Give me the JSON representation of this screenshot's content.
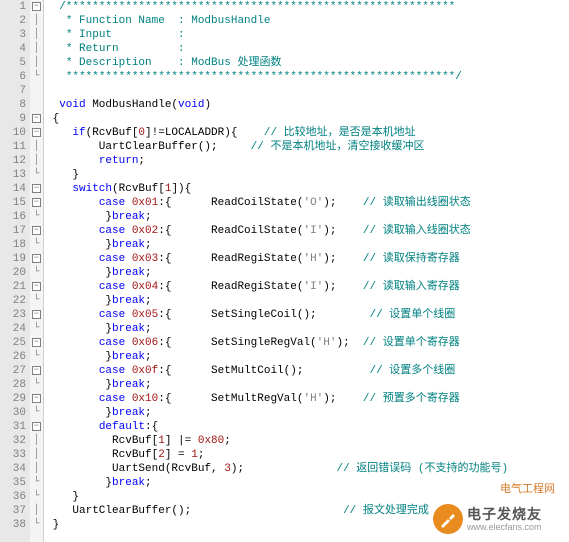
{
  "lines": [
    {
      "n": 1,
      "fold": "box",
      "segs": [
        {
          "txt": "  ",
          "cls": ""
        },
        {
          "txt": "/***********************************************************",
          "cls": "cmt"
        }
      ]
    },
    {
      "n": 2,
      "fold": "|",
      "segs": [
        {
          "txt": "   ",
          "cls": ""
        },
        {
          "txt": "* Function Name  : ModbusHandle",
          "cls": "cmt"
        }
      ]
    },
    {
      "n": 3,
      "fold": "|",
      "segs": [
        {
          "txt": "   ",
          "cls": ""
        },
        {
          "txt": "* Input          :",
          "cls": "cmt"
        }
      ]
    },
    {
      "n": 4,
      "fold": "|",
      "segs": [
        {
          "txt": "   ",
          "cls": ""
        },
        {
          "txt": "* Return         :",
          "cls": "cmt"
        }
      ]
    },
    {
      "n": 5,
      "fold": "|",
      "segs": [
        {
          "txt": "   ",
          "cls": ""
        },
        {
          "txt": "* Description    : ModBus 处理函数",
          "cls": "cmt"
        }
      ]
    },
    {
      "n": 6,
      "fold": "L",
      "segs": [
        {
          "txt": "   ",
          "cls": ""
        },
        {
          "txt": "***********************************************************/",
          "cls": "cmt"
        }
      ]
    },
    {
      "n": 7,
      "fold": " ",
      "segs": [
        {
          "txt": "",
          "cls": ""
        }
      ]
    },
    {
      "n": 8,
      "fold": " ",
      "segs": [
        {
          "txt": "  ",
          "cls": ""
        },
        {
          "txt": "void",
          "cls": "kw"
        },
        {
          "txt": " ModbusHandle(",
          "cls": ""
        },
        {
          "txt": "void",
          "cls": "kw"
        },
        {
          "txt": ")",
          "cls": ""
        }
      ]
    },
    {
      "n": 9,
      "fold": "box",
      "segs": [
        {
          "txt": " {",
          "cls": ""
        }
      ]
    },
    {
      "n": 10,
      "fold": "box",
      "segs": [
        {
          "txt": "    ",
          "cls": ""
        },
        {
          "txt": "if",
          "cls": "kw"
        },
        {
          "txt": "(RcvBuf[",
          "cls": ""
        },
        {
          "txt": "0",
          "cls": "num"
        },
        {
          "txt": "]!=LOCALADDR){    ",
          "cls": ""
        },
        {
          "txt": "// 比较地址，是否是本机地址",
          "cls": "cmt"
        }
      ]
    },
    {
      "n": 11,
      "fold": "|",
      "segs": [
        {
          "txt": "        UartClearBuffer();     ",
          "cls": ""
        },
        {
          "txt": "// 不是本机地址，清空接收缓冲区",
          "cls": "cmt"
        }
      ]
    },
    {
      "n": 12,
      "fold": "|",
      "segs": [
        {
          "txt": "        ",
          "cls": ""
        },
        {
          "txt": "return",
          "cls": "kw"
        },
        {
          "txt": ";",
          "cls": ""
        }
      ]
    },
    {
      "n": 13,
      "fold": "L",
      "segs": [
        {
          "txt": "    }",
          "cls": ""
        }
      ]
    },
    {
      "n": 14,
      "fold": "box",
      "segs": [
        {
          "txt": "    ",
          "cls": ""
        },
        {
          "txt": "switch",
          "cls": "kw"
        },
        {
          "txt": "(RcvBuf[",
          "cls": ""
        },
        {
          "txt": "1",
          "cls": "num"
        },
        {
          "txt": "]){",
          "cls": ""
        }
      ]
    },
    {
      "n": 15,
      "fold": "box",
      "segs": [
        {
          "txt": "        ",
          "cls": ""
        },
        {
          "txt": "case",
          "cls": "kw"
        },
        {
          "txt": " ",
          "cls": ""
        },
        {
          "txt": "0x01",
          "cls": "num"
        },
        {
          "txt": ":{      ReadCoilState(",
          "cls": ""
        },
        {
          "txt": "'O'",
          "cls": "str"
        },
        {
          "txt": ");    ",
          "cls": ""
        },
        {
          "txt": "// 读取输出线圈状态",
          "cls": "cmt"
        }
      ]
    },
    {
      "n": 16,
      "fold": "L",
      "segs": [
        {
          "txt": "         }",
          "cls": ""
        },
        {
          "txt": "break",
          "cls": "kw"
        },
        {
          "txt": ";",
          "cls": ""
        }
      ]
    },
    {
      "n": 17,
      "fold": "box",
      "segs": [
        {
          "txt": "        ",
          "cls": ""
        },
        {
          "txt": "case",
          "cls": "kw"
        },
        {
          "txt": " ",
          "cls": ""
        },
        {
          "txt": "0x02",
          "cls": "num"
        },
        {
          "txt": ":{      ReadCoilState(",
          "cls": ""
        },
        {
          "txt": "'I'",
          "cls": "str"
        },
        {
          "txt": ");    ",
          "cls": ""
        },
        {
          "txt": "// 读取输入线圈状态",
          "cls": "cmt"
        }
      ]
    },
    {
      "n": 18,
      "fold": "L",
      "segs": [
        {
          "txt": "         }",
          "cls": ""
        },
        {
          "txt": "break",
          "cls": "kw"
        },
        {
          "txt": ";",
          "cls": ""
        }
      ]
    },
    {
      "n": 19,
      "fold": "box",
      "segs": [
        {
          "txt": "        ",
          "cls": ""
        },
        {
          "txt": "case",
          "cls": "kw"
        },
        {
          "txt": " ",
          "cls": ""
        },
        {
          "txt": "0x03",
          "cls": "num"
        },
        {
          "txt": ":{      ReadRegiState(",
          "cls": ""
        },
        {
          "txt": "'H'",
          "cls": "str"
        },
        {
          "txt": ");    ",
          "cls": ""
        },
        {
          "txt": "// 读取保持寄存器",
          "cls": "cmt"
        }
      ]
    },
    {
      "n": 20,
      "fold": "L",
      "segs": [
        {
          "txt": "         }",
          "cls": ""
        },
        {
          "txt": "break",
          "cls": "kw"
        },
        {
          "txt": ";",
          "cls": ""
        }
      ]
    },
    {
      "n": 21,
      "fold": "box",
      "segs": [
        {
          "txt": "        ",
          "cls": ""
        },
        {
          "txt": "case",
          "cls": "kw"
        },
        {
          "txt": " ",
          "cls": ""
        },
        {
          "txt": "0x04",
          "cls": "num"
        },
        {
          "txt": ":{      ReadRegiState(",
          "cls": ""
        },
        {
          "txt": "'I'",
          "cls": "str"
        },
        {
          "txt": ");    ",
          "cls": ""
        },
        {
          "txt": "// 读取输入寄存器",
          "cls": "cmt"
        }
      ]
    },
    {
      "n": 22,
      "fold": "L",
      "segs": [
        {
          "txt": "         }",
          "cls": ""
        },
        {
          "txt": "break",
          "cls": "kw"
        },
        {
          "txt": ";",
          "cls": ""
        }
      ]
    },
    {
      "n": 23,
      "fold": "box",
      "segs": [
        {
          "txt": "        ",
          "cls": ""
        },
        {
          "txt": "case",
          "cls": "kw"
        },
        {
          "txt": " ",
          "cls": ""
        },
        {
          "txt": "0x05",
          "cls": "num"
        },
        {
          "txt": ":{      SetSingleCoil();        ",
          "cls": ""
        },
        {
          "txt": "// 设置单个线圈",
          "cls": "cmt"
        }
      ]
    },
    {
      "n": 24,
      "fold": "L",
      "segs": [
        {
          "txt": "         }",
          "cls": ""
        },
        {
          "txt": "break",
          "cls": "kw"
        },
        {
          "txt": ";",
          "cls": ""
        }
      ]
    },
    {
      "n": 25,
      "fold": "box",
      "segs": [
        {
          "txt": "        ",
          "cls": ""
        },
        {
          "txt": "case",
          "cls": "kw"
        },
        {
          "txt": " ",
          "cls": ""
        },
        {
          "txt": "0x06",
          "cls": "num"
        },
        {
          "txt": ":{      SetSingleRegVal(",
          "cls": ""
        },
        {
          "txt": "'H'",
          "cls": "str"
        },
        {
          "txt": ");  ",
          "cls": ""
        },
        {
          "txt": "// 设置单个寄存器",
          "cls": "cmt"
        }
      ]
    },
    {
      "n": 26,
      "fold": "L",
      "segs": [
        {
          "txt": "         }",
          "cls": ""
        },
        {
          "txt": "break",
          "cls": "kw"
        },
        {
          "txt": ";",
          "cls": ""
        }
      ]
    },
    {
      "n": 27,
      "fold": "box",
      "segs": [
        {
          "txt": "        ",
          "cls": ""
        },
        {
          "txt": "case",
          "cls": "kw"
        },
        {
          "txt": " ",
          "cls": ""
        },
        {
          "txt": "0x0f",
          "cls": "num"
        },
        {
          "txt": ":{      SetMultCoil();          ",
          "cls": ""
        },
        {
          "txt": "// 设置多个线圈",
          "cls": "cmt"
        }
      ]
    },
    {
      "n": 28,
      "fold": "L",
      "segs": [
        {
          "txt": "         }",
          "cls": ""
        },
        {
          "txt": "break",
          "cls": "kw"
        },
        {
          "txt": ";",
          "cls": ""
        }
      ]
    },
    {
      "n": 29,
      "fold": "box",
      "segs": [
        {
          "txt": "        ",
          "cls": ""
        },
        {
          "txt": "case",
          "cls": "kw"
        },
        {
          "txt": " ",
          "cls": ""
        },
        {
          "txt": "0x10",
          "cls": "num"
        },
        {
          "txt": ":{      SetMultRegVal(",
          "cls": ""
        },
        {
          "txt": "'H'",
          "cls": "str"
        },
        {
          "txt": ");    ",
          "cls": ""
        },
        {
          "txt": "// 预置多个寄存器",
          "cls": "cmt"
        }
      ]
    },
    {
      "n": 30,
      "fold": "L",
      "segs": [
        {
          "txt": "         }",
          "cls": ""
        },
        {
          "txt": "break",
          "cls": "kw"
        },
        {
          "txt": ";",
          "cls": ""
        }
      ]
    },
    {
      "n": 31,
      "fold": "box",
      "segs": [
        {
          "txt": "        ",
          "cls": ""
        },
        {
          "txt": "default",
          "cls": "kw"
        },
        {
          "txt": ":{",
          "cls": ""
        }
      ]
    },
    {
      "n": 32,
      "fold": "|",
      "segs": [
        {
          "txt": "          RcvBuf[",
          "cls": ""
        },
        {
          "txt": "1",
          "cls": "num"
        },
        {
          "txt": "] |= ",
          "cls": ""
        },
        {
          "txt": "0x80",
          "cls": "num"
        },
        {
          "txt": ";",
          "cls": ""
        }
      ]
    },
    {
      "n": 33,
      "fold": "|",
      "segs": [
        {
          "txt": "          RcvBuf[",
          "cls": ""
        },
        {
          "txt": "2",
          "cls": "num"
        },
        {
          "txt": "] = ",
          "cls": ""
        },
        {
          "txt": "1",
          "cls": "num"
        },
        {
          "txt": ";",
          "cls": ""
        }
      ]
    },
    {
      "n": 34,
      "fold": "|",
      "segs": [
        {
          "txt": "          UartSend(RcvBuf, ",
          "cls": ""
        },
        {
          "txt": "3",
          "cls": "num"
        },
        {
          "txt": ");              ",
          "cls": ""
        },
        {
          "txt": "// 返回错误码 (不支持的功能号)",
          "cls": "cmt"
        }
      ]
    },
    {
      "n": 35,
      "fold": "L",
      "segs": [
        {
          "txt": "         }",
          "cls": ""
        },
        {
          "txt": "break",
          "cls": "kw"
        },
        {
          "txt": ";",
          "cls": ""
        }
      ]
    },
    {
      "n": 36,
      "fold": "L",
      "segs": [
        {
          "txt": "    }",
          "cls": ""
        }
      ]
    },
    {
      "n": 37,
      "fold": "|",
      "segs": [
        {
          "txt": "    UartClearBuffer();                       ",
          "cls": ""
        },
        {
          "txt": "// 报文处理完成",
          "cls": "cmt"
        }
      ]
    },
    {
      "n": 38,
      "fold": "L",
      "segs": [
        {
          "txt": " }",
          "cls": ""
        }
      ]
    }
  ],
  "watermark": {
    "top_text": "电气工程网",
    "logo_text1": "电子发烧友",
    "logo_text2": "www.elecfans.com"
  }
}
